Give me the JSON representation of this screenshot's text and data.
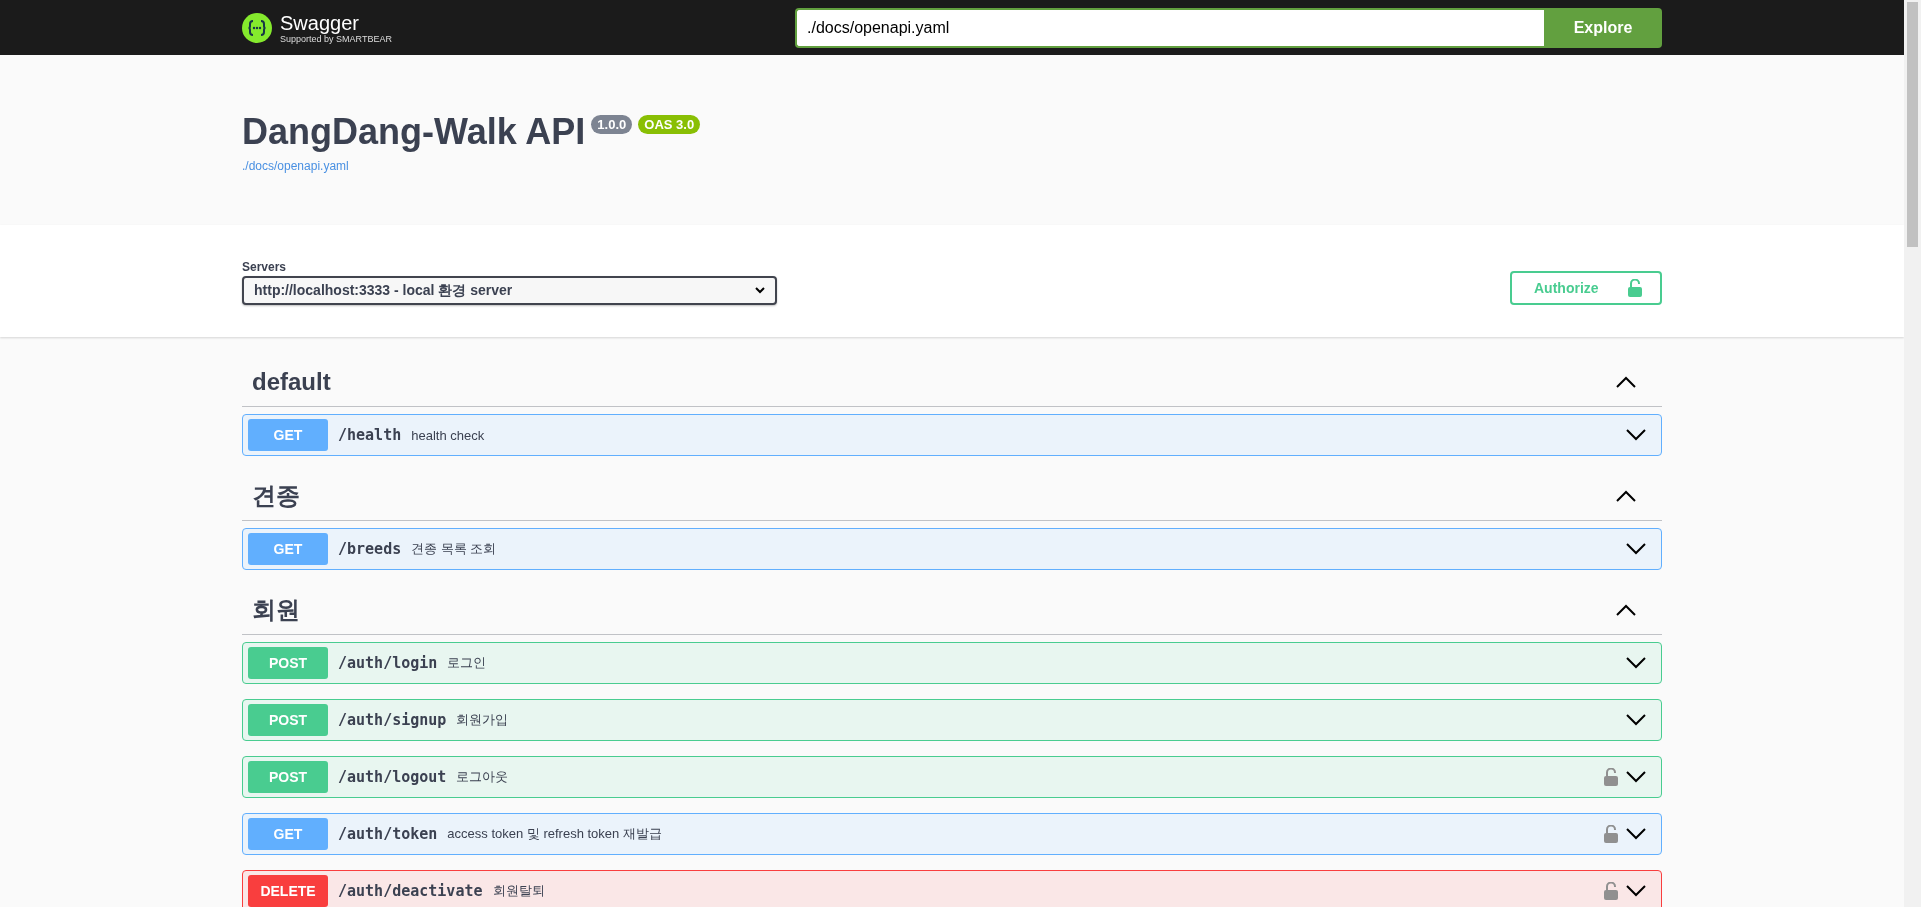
{
  "topbar": {
    "brand": "Swagger",
    "brand_sub": "Supported by SMARTBEAR",
    "url": "./docs/openapi.yaml",
    "explore": "Explore"
  },
  "info": {
    "title": "DangDang-Walk API",
    "version": "1.0.0",
    "oas": "OAS 3.0",
    "link": "./docs/openapi.yaml"
  },
  "servers": {
    "label": "Servers",
    "selected": "http://localhost:3333 - local 환경 server",
    "authorize": "Authorize"
  },
  "tags": [
    {
      "name": "default",
      "expanded": true,
      "operations": [
        {
          "method": "GET",
          "path": "/health",
          "summary": "health check",
          "locked": false
        }
      ]
    },
    {
      "name": "견종",
      "expanded": true,
      "operations": [
        {
          "method": "GET",
          "path": "/breeds",
          "summary": "견종 목록 조회",
          "locked": false
        }
      ]
    },
    {
      "name": "회원",
      "expanded": true,
      "operations": [
        {
          "method": "POST",
          "path": "/auth/login",
          "summary": "로그인",
          "locked": false
        },
        {
          "method": "POST",
          "path": "/auth/signup",
          "summary": "회원가입",
          "locked": false
        },
        {
          "method": "POST",
          "path": "/auth/logout",
          "summary": "로그아웃",
          "locked": true
        },
        {
          "method": "GET",
          "path": "/auth/token",
          "summary": "access token 및 refresh token 재발급",
          "locked": true
        },
        {
          "method": "DELETE",
          "path": "/auth/deactivate",
          "summary": "회원탈퇴",
          "locked": true
        }
      ]
    }
  ]
}
